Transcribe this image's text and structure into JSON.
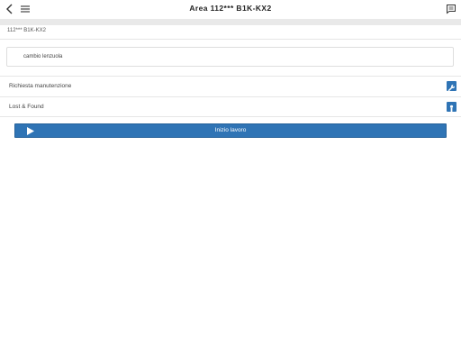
{
  "header": {
    "title": "Area 112*** B1K-KX2",
    "back_icon": "chevron-left-icon",
    "menu_icon": "hamburger-menu-icon",
    "chat_icon": "chat-message-icon"
  },
  "subtitle": "112*** B1K-KX2",
  "note": "cambio lenzuola",
  "actions": [
    {
      "label": "Richiesta manutenzione",
      "icon": "wrench-icon"
    },
    {
      "label": "Lost & Found",
      "icon": "lost-found-icon"
    }
  ],
  "start_button": {
    "label": "Inizio lavoro",
    "icon": "play-icon"
  },
  "colors": {
    "accent": "#2f74b5",
    "separator": "#e9e9e9"
  }
}
